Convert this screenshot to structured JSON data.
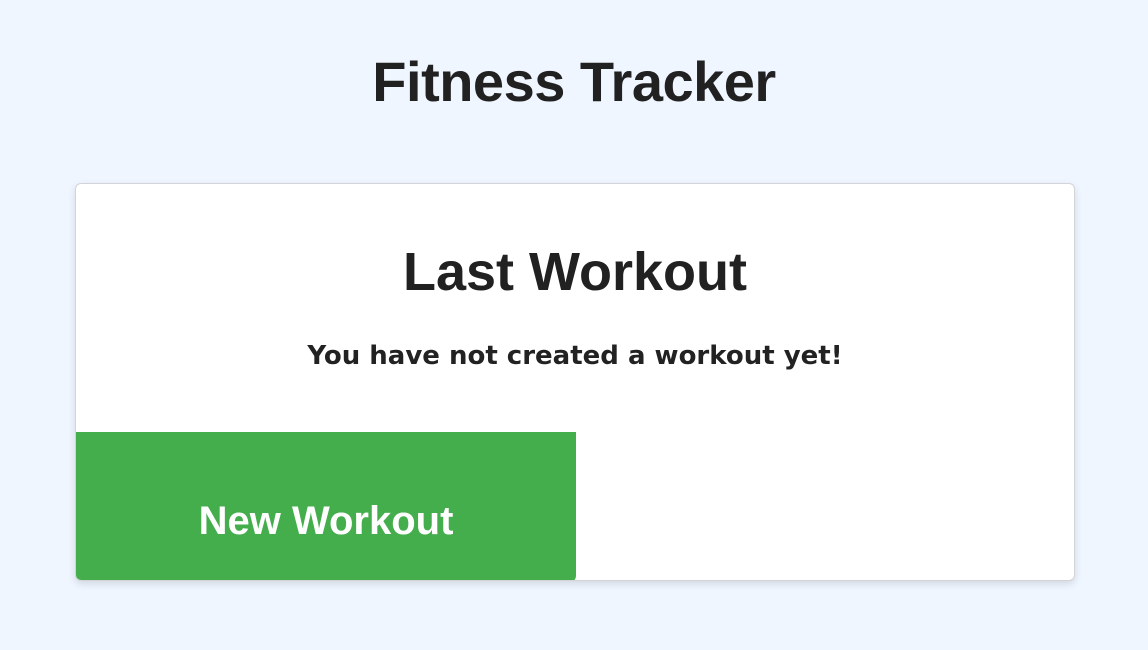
{
  "header": {
    "title": "Fitness Tracker"
  },
  "last_workout_card": {
    "title": "Last Workout",
    "message": "You have not created a workout yet!",
    "new_workout_label": "New Workout"
  },
  "colors": {
    "background": "#eff6ff",
    "card": "#ffffff",
    "button": "#44ad4c",
    "text": "#212121"
  }
}
